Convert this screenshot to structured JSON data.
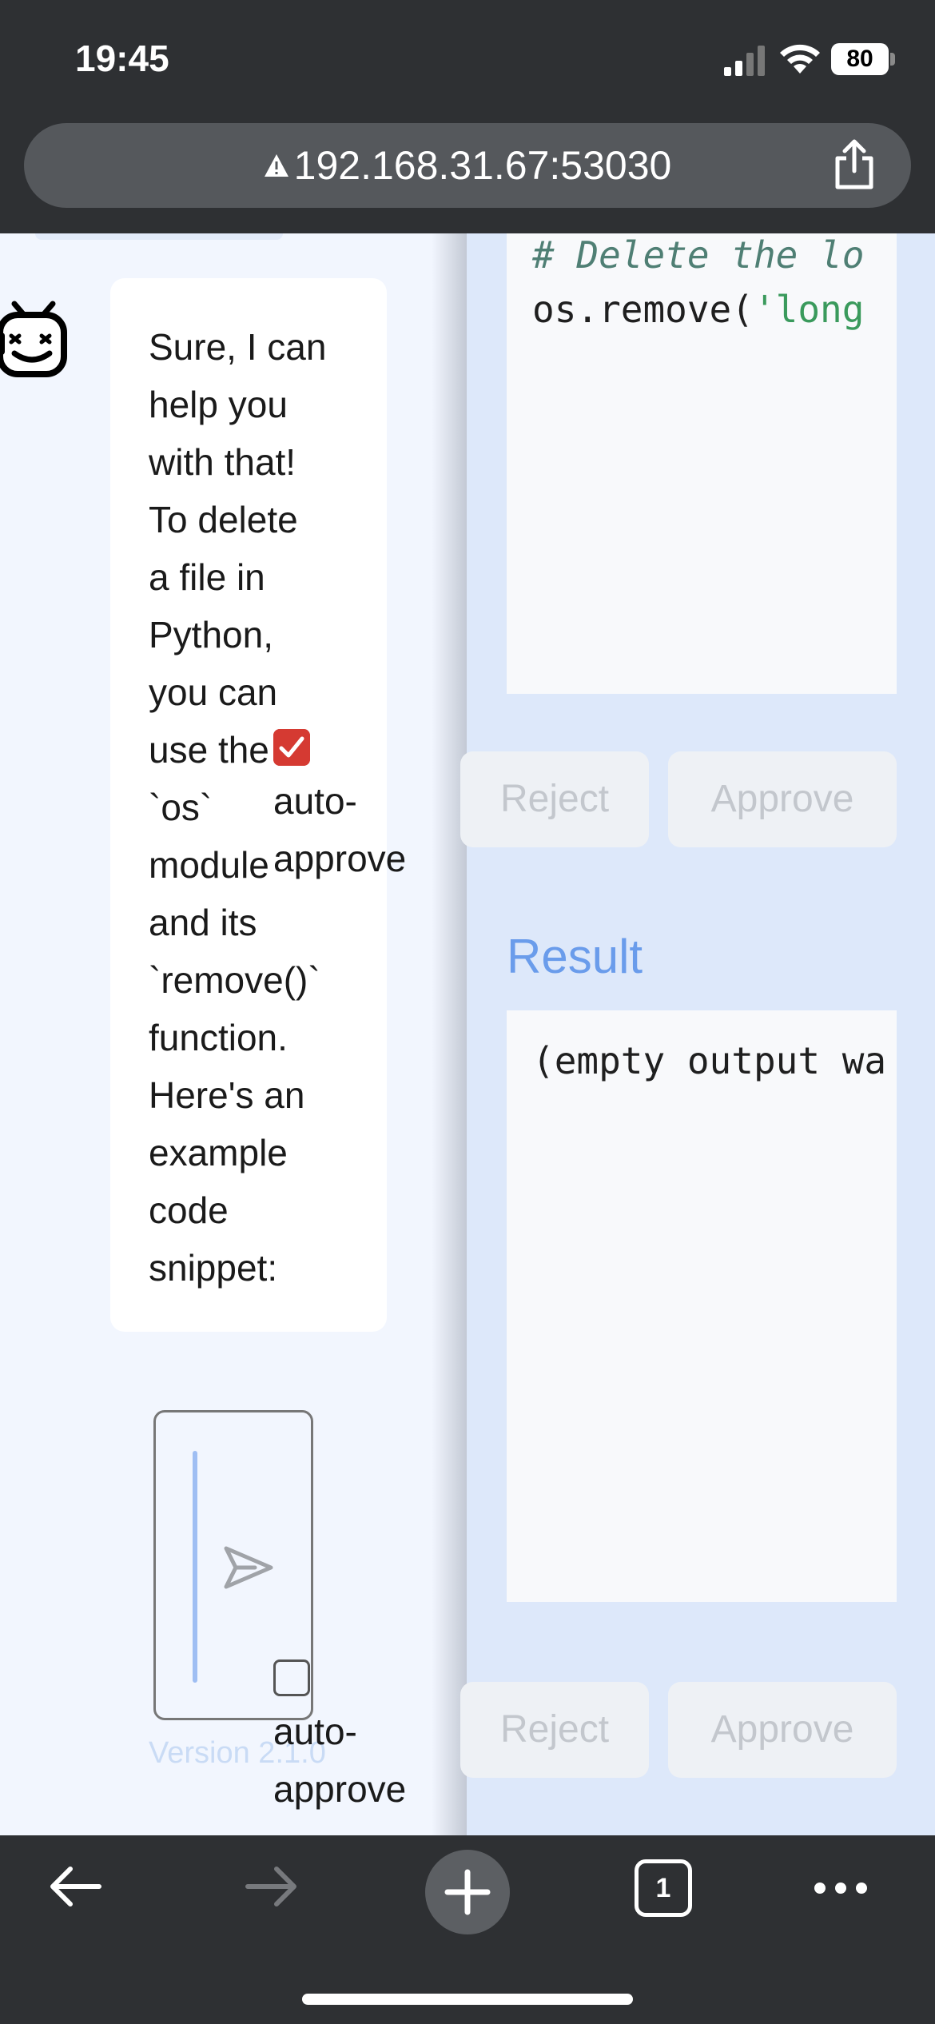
{
  "status_bar": {
    "time": "19:45",
    "battery": "80",
    "icons": [
      "signal-icon",
      "wifi-icon",
      "battery-icon"
    ]
  },
  "browser": {
    "url": "192.168.31.67:53030",
    "url_icon": "warning-icon",
    "share_icon": "share-icon",
    "tab_count": "1"
  },
  "chat": {
    "bot_icon": "robot-icon",
    "message": "Sure, I can\nhelp you\nwith that!\nTo delete\na file in\nPython,\nyou can\nuse the\n`os`\nmodule\nand its\n`remove()`\nfunction.\nHere's an\nexample\ncode\nsnippet:",
    "auto_approve_top": {
      "label": "auto-\napprove",
      "checked": true
    },
    "auto_approve_bottom": {
      "label": "auto-\napprove",
      "checked": false
    },
    "send_icon": "send-icon",
    "version": "Version 2.1.0"
  },
  "tool_panel": {
    "code_comment": "# Delete the lo",
    "code_call_prefix": "os.remove(",
    "code_call_string": "'long",
    "reject_label": "Reject",
    "approve_label": "Approve",
    "result_title": "Result",
    "result_text": "(empty output wa"
  },
  "colors": {
    "accent": "#6a9ceb",
    "checkbox_checked": "#d53a32",
    "chrome": "#2e3033"
  }
}
